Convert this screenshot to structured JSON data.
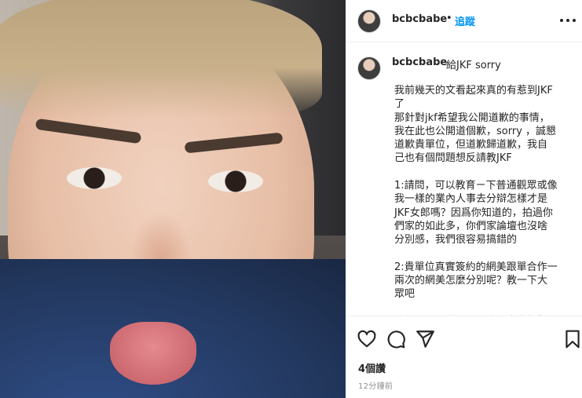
{
  "post": {
    "username": "bcbcbabe",
    "separator": "•",
    "follow_label": "追蹤",
    "caption_head": "給JKF sorry",
    "caption_lines": [
      "我前幾天的文看起來真的有惹到JKF",
      "了",
      "那針對jkf希望我公開道歉的事情，",
      "我在此也公開道個歉，sorry ，誠懇",
      "道歉貴單位，但道歉歸道歉，我自",
      "己也有個問題想反請教JKF",
      "",
      "1:請問，可以教育ㄧ下普通觀眾或像",
      "我一樣的業內人事去分辯怎樣才是",
      "JKF女郎嗎？因爲你知道的，拍過你",
      "們家的如此多，你們家論壇也沒啥",
      "分別感，我們很容易搞錯的",
      "",
      "2:貴單位真實簽約的網美跟單合作一",
      "兩次的網美怎麼分別呢？教一下大",
      "眾吧",
      "",
      "我覺得以上的兩題是我分出來相對"
    ],
    "likes": "4個讚",
    "time_ago": "12分鐘前"
  },
  "icons": [
    "more-icon",
    "heart-icon",
    "comment-icon",
    "share-icon",
    "bookmark-icon"
  ]
}
